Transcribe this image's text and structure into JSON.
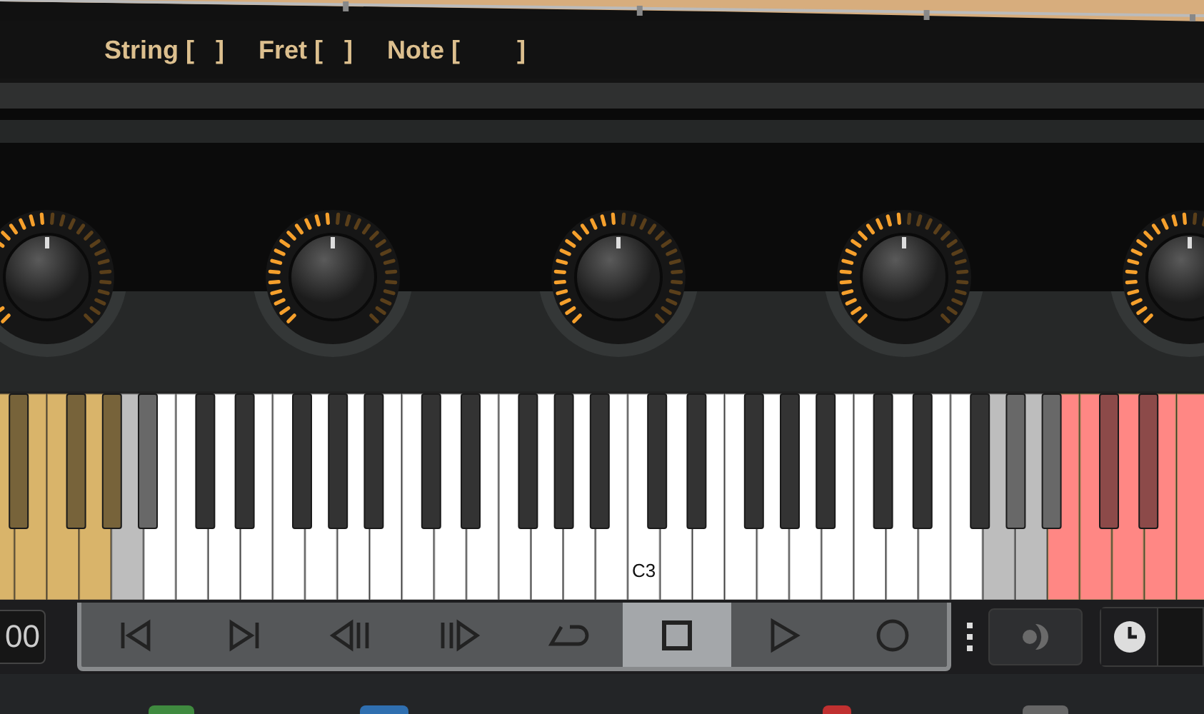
{
  "fret_info": [
    {
      "label": "String [   ]"
    },
    {
      "label": "Fret [   ]"
    },
    {
      "label": "Note [        ]"
    }
  ],
  "knobs": [
    {
      "level": 0.5
    },
    {
      "level": 0.5
    },
    {
      "level": 0.5
    },
    {
      "level": 0.5
    },
    {
      "level": 0.5
    }
  ],
  "keyboard": {
    "keys": [
      {
        "kind": "keyswitch",
        "color": "#d9b46a"
      },
      {
        "kind": "keyswitch",
        "color": "#d9b46a"
      },
      {
        "kind": "keyswitch",
        "color": "#d9b46a"
      },
      {
        "kind": "keyswitch",
        "color": "#d9b46a"
      },
      {
        "kind": "out-of-range",
        "color": "#bdbdbd"
      },
      {
        "kind": "playable",
        "color": "#ffffff"
      },
      {
        "kind": "playable",
        "color": "#ffffff"
      },
      {
        "kind": "playable",
        "color": "#ffffff"
      },
      {
        "kind": "playable",
        "color": "#ffffff"
      },
      {
        "kind": "playable",
        "color": "#ffffff"
      },
      {
        "kind": "playable",
        "color": "#ffffff"
      },
      {
        "kind": "playable",
        "color": "#ffffff"
      },
      {
        "kind": "playable",
        "color": "#ffffff"
      },
      {
        "kind": "playable",
        "color": "#ffffff"
      },
      {
        "kind": "playable",
        "color": "#ffffff"
      },
      {
        "kind": "playable",
        "color": "#ffffff"
      },
      {
        "kind": "playable",
        "color": "#ffffff"
      },
      {
        "kind": "playable",
        "color": "#ffffff"
      },
      {
        "kind": "playable",
        "color": "#ffffff"
      },
      {
        "kind": "playable",
        "color": "#ffffff"
      },
      {
        "kind": "playable",
        "color": "#ffffff",
        "label": "C3"
      },
      {
        "kind": "playable",
        "color": "#ffffff"
      },
      {
        "kind": "playable",
        "color": "#ffffff"
      },
      {
        "kind": "playable",
        "color": "#ffffff"
      },
      {
        "kind": "playable",
        "color": "#ffffff"
      },
      {
        "kind": "playable",
        "color": "#ffffff"
      },
      {
        "kind": "playable",
        "color": "#ffffff"
      },
      {
        "kind": "playable",
        "color": "#ffffff"
      },
      {
        "kind": "playable",
        "color": "#ffffff"
      },
      {
        "kind": "playable",
        "color": "#ffffff"
      },
      {
        "kind": "playable",
        "color": "#ffffff"
      },
      {
        "kind": "out-of-range",
        "color": "#bdbdbd"
      },
      {
        "kind": "out-of-range",
        "color": "#bdbdbd"
      },
      {
        "kind": "keyswitch",
        "color": "#ff8784"
      },
      {
        "kind": "keyswitch",
        "color": "#ff8784"
      },
      {
        "kind": "keyswitch",
        "color": "#ff8784"
      },
      {
        "kind": "keyswitch",
        "color": "#ff8784"
      },
      {
        "kind": "keyswitch",
        "color": "#ff8784"
      }
    ]
  },
  "counter": "00",
  "transport": [
    {
      "kind": "to-start",
      "selected": false
    },
    {
      "kind": "to-end",
      "selected": false
    },
    {
      "kind": "step-back",
      "selected": false
    },
    {
      "kind": "step-forward",
      "selected": false
    },
    {
      "kind": "loop",
      "selected": false
    },
    {
      "kind": "stop",
      "selected": true
    },
    {
      "kind": "play",
      "selected": false
    },
    {
      "kind": "record",
      "selected": false
    }
  ]
}
